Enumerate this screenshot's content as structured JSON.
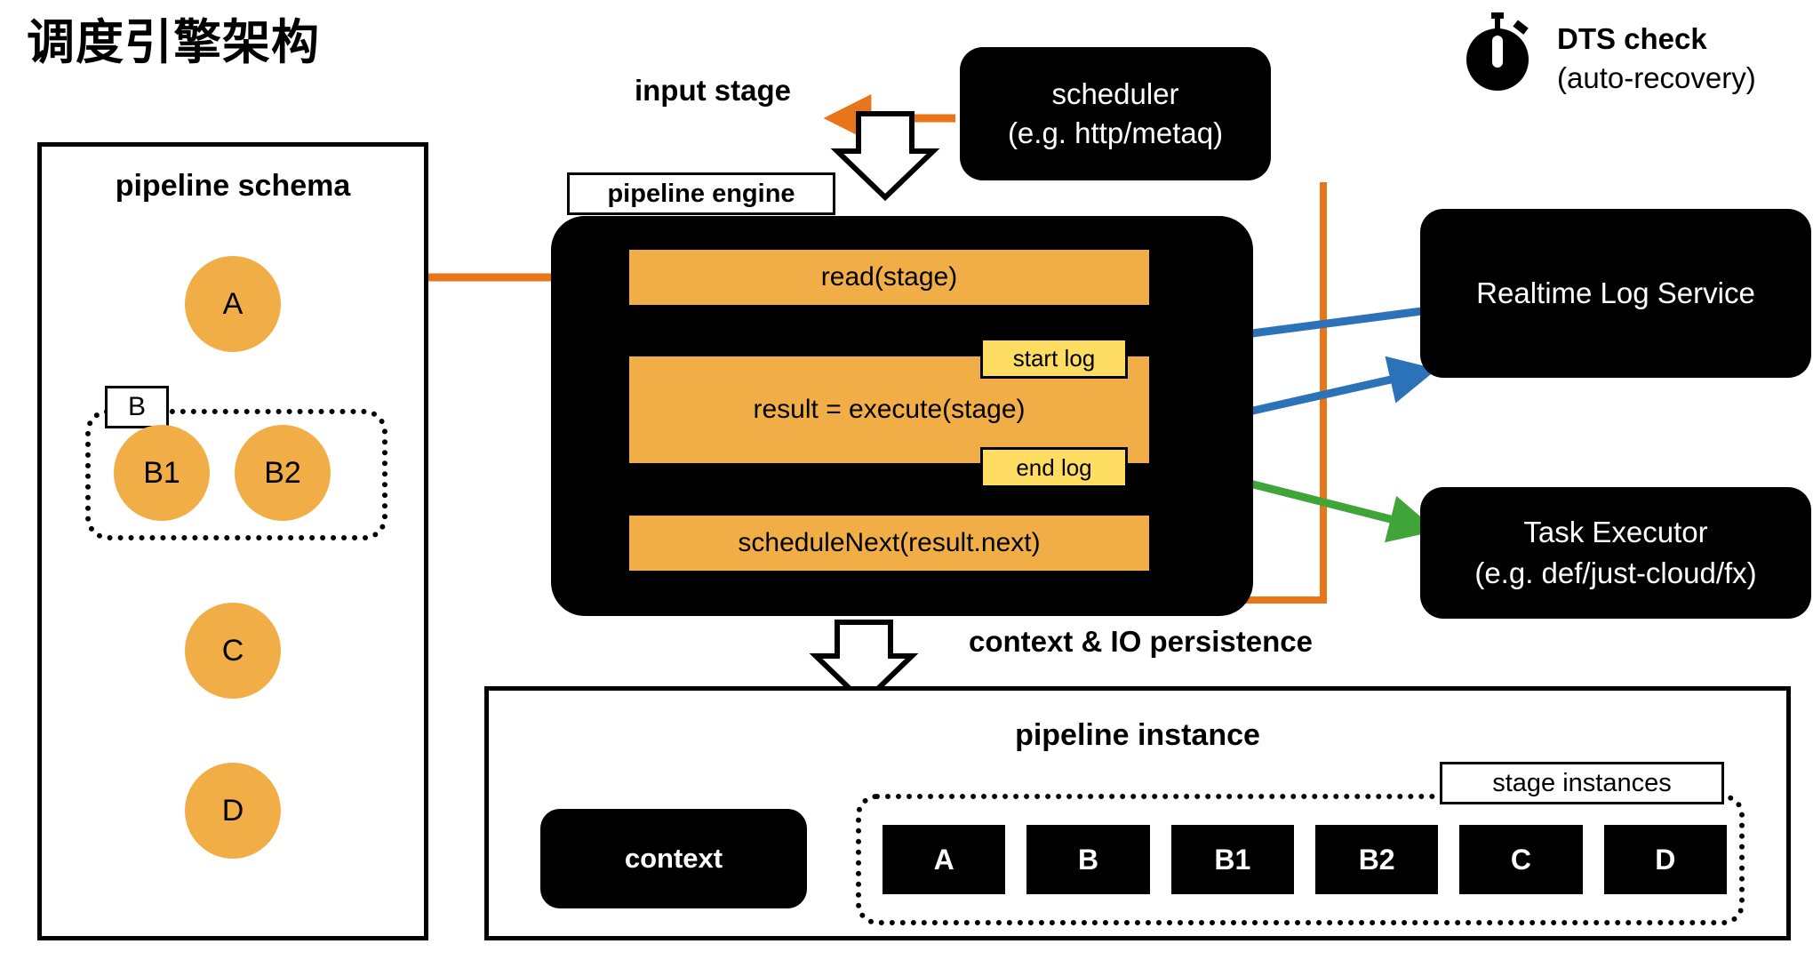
{
  "title": "调度引擎架构",
  "schema": {
    "panel_title": "pipeline schema",
    "group_label": "B",
    "nodes": [
      {
        "id": "a",
        "label": "A"
      },
      {
        "id": "b1",
        "label": "B1"
      },
      {
        "id": "b2",
        "label": "B2"
      },
      {
        "id": "c",
        "label": "C"
      },
      {
        "id": "d",
        "label": "D"
      }
    ]
  },
  "engine": {
    "label": "pipeline engine",
    "input_stage_label": "input stage",
    "steps": [
      {
        "id": "read",
        "label": "read(stage)"
      },
      {
        "id": "execute",
        "label": "result = execute(stage)"
      },
      {
        "id": "scheduleNext",
        "label": "scheduleNext(result.next)"
      }
    ],
    "logs": [
      {
        "id": "start",
        "label": "start log"
      },
      {
        "id": "end",
        "label": "end log"
      }
    ]
  },
  "scheduler": {
    "line1": "scheduler",
    "line2": "(e.g. http/metaq)"
  },
  "dts": {
    "icon": "stopwatch-icon",
    "line1": "DTS check",
    "line2": "(auto-recovery)"
  },
  "services": [
    {
      "id": "log",
      "line1": "Realtime Log Service",
      "line2": ""
    },
    {
      "id": "exec",
      "line1": "Task Executor",
      "line2": "(e.g. def/just-cloud/fx)"
    }
  ],
  "persistence_label": "context & IO persistence",
  "instance": {
    "title": "pipeline instance",
    "context_label": "context",
    "stage_instances_label": "stage instances",
    "stages": [
      "A",
      "B",
      "B1",
      "B2",
      "C",
      "D"
    ]
  },
  "colors": {
    "node_orange": "#F2AE46",
    "log_yellow": "#FFDD63",
    "arrow_orange": "#E8751A",
    "arrow_blue": "#2C72B8",
    "arrow_green": "#3FA539",
    "black": "#000000",
    "white": "#FFFFFF"
  }
}
